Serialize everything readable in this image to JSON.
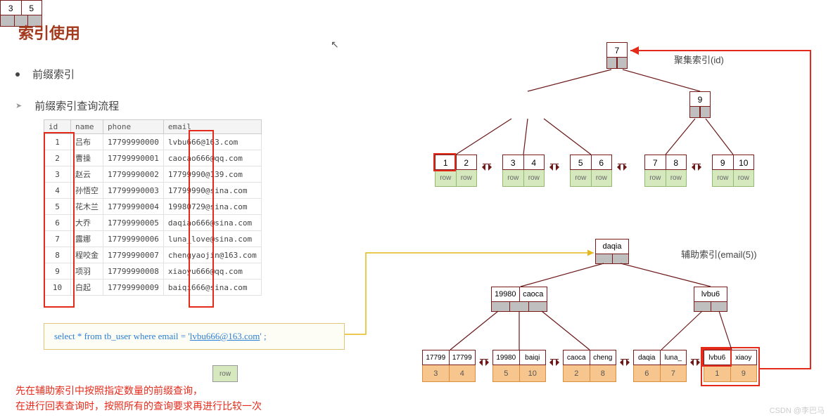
{
  "title": "索引使用",
  "bullet1": "前缀索引",
  "bullet2": "前缀索引查询流程",
  "labels": {
    "clustered": "聚集索引(id)",
    "secondary": "辅助索引(email(5))"
  },
  "table": {
    "headers": {
      "id": "id",
      "name": "name",
      "phone": "phone",
      "email": "email"
    },
    "rows": [
      {
        "id": "1",
        "name": "吕布",
        "phone": "17799990000",
        "email": "lvbu666@163.com"
      },
      {
        "id": "2",
        "name": "曹操",
        "phone": "17799990001",
        "email": "caocao666@qq.com"
      },
      {
        "id": "3",
        "name": "赵云",
        "phone": "17799990002",
        "email": "17799990@139.com"
      },
      {
        "id": "4",
        "name": "孙悟空",
        "phone": "17799990003",
        "email": "17799990@sina.com"
      },
      {
        "id": "5",
        "name": "花木兰",
        "phone": "17799990004",
        "email": "19980729@sina.com"
      },
      {
        "id": "6",
        "name": "大乔",
        "phone": "17799990005",
        "email": "daqiao666@sina.com"
      },
      {
        "id": "7",
        "name": "露娜",
        "phone": "17799990006",
        "email": "luna_love@sina.com"
      },
      {
        "id": "8",
        "name": "程咬金",
        "phone": "17799990007",
        "email": "chengyaojin@163.com"
      },
      {
        "id": "9",
        "name": "项羽",
        "phone": "17799990008",
        "email": "xiaoyu666@qq.com"
      },
      {
        "id": "10",
        "name": "白起",
        "phone": "17799990009",
        "email": "baiqi666@sina.com"
      }
    ]
  },
  "sql": {
    "prefix": "select * from tb_user where email = '",
    "hl": "lvbu666@163.com",
    "suffix": "' ;"
  },
  "rowlabel": "row",
  "redtext": {
    "l1": "先在辅助索引中按照指定数量的前缀查询，",
    "l2": "在进行回表查询时，按照所有的查询要求再进行比较一次"
  },
  "tree1": {
    "root": "7",
    "mid": {
      "left": [
        "3",
        "5"
      ],
      "right": [
        "9"
      ]
    },
    "leaves": [
      {
        "k": [
          "1",
          "2"
        ],
        "r": [
          "row",
          "row"
        ]
      },
      {
        "k": [
          "3",
          "4"
        ],
        "r": [
          "row",
          "row"
        ]
      },
      {
        "k": [
          "5",
          "6"
        ],
        "r": [
          "row",
          "row"
        ]
      },
      {
        "k": [
          "7",
          "8"
        ],
        "r": [
          "row",
          "row"
        ]
      },
      {
        "k": [
          "9",
          "10"
        ],
        "r": [
          "row",
          "row"
        ]
      }
    ]
  },
  "tree2": {
    "root": "daqia",
    "mid": {
      "left": [
        "19980",
        "caoca"
      ],
      "right": [
        "lvbu6"
      ]
    },
    "leaves": [
      {
        "k": [
          "17799",
          "17799"
        ],
        "i": [
          "3",
          "4"
        ]
      },
      {
        "k": [
          "19980",
          "baiqi"
        ],
        "i": [
          "5",
          "10"
        ]
      },
      {
        "k": [
          "caoca",
          "cheng"
        ],
        "i": [
          "2",
          "8"
        ]
      },
      {
        "k": [
          "daqia",
          "luna_"
        ],
        "i": [
          "6",
          "7"
        ]
      },
      {
        "k": [
          "lvbu6",
          "xiaoy"
        ],
        "i": [
          "1",
          "9"
        ]
      }
    ]
  },
  "watermark": "CSDN @李巴马"
}
